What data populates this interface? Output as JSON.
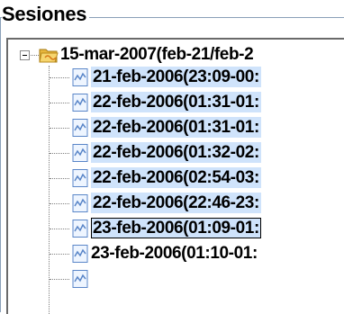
{
  "group": {
    "title": "Sesiones"
  },
  "tree": {
    "root": {
      "label": "15-mar-2007(feb-21/feb-2",
      "icon": "open-folder-icon"
    },
    "children": [
      {
        "label": "21-feb-2006(23:09-00:",
        "icon": "chart-document-icon"
      },
      {
        "label": "22-feb-2006(01:31-01:",
        "icon": "chart-document-icon"
      },
      {
        "label": "22-feb-2006(01:31-01:",
        "icon": "chart-document-icon"
      },
      {
        "label": "22-feb-2006(01:32-02:",
        "icon": "chart-document-icon"
      },
      {
        "label": "22-feb-2006(02:54-03:",
        "icon": "chart-document-icon"
      },
      {
        "label": "22-feb-2006(22:46-23:",
        "icon": "chart-document-icon"
      },
      {
        "label": "23-feb-2006(01:09-01:",
        "icon": "chart-document-icon"
      },
      {
        "label": "23-feb-2006(01:10-01:",
        "icon": "chart-document-icon"
      }
    ]
  },
  "colors": {
    "selection": "#cfe3fb",
    "groupbox_line": "#8aa0b8",
    "folder": "#f2c94c"
  }
}
